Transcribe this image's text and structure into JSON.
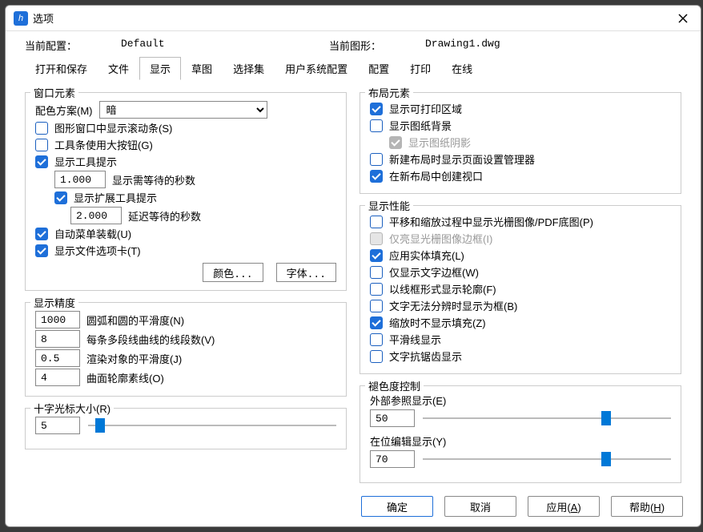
{
  "window": {
    "title": "选项"
  },
  "topbar": {
    "config_label": "当前配置：",
    "config_value": "Default",
    "drawing_label": "当前图形：",
    "drawing_value": "Drawing1.dwg"
  },
  "tabs": [
    "打开和保存",
    "文件",
    "显示",
    "草图",
    "选择集",
    "用户系统配置",
    "配置",
    "打印",
    "在线"
  ],
  "active_tab": "显示",
  "window_elements": {
    "title": "窗口元素",
    "colorscheme_label": "配色方案(M)",
    "colorscheme_value": "暗",
    "scrollbars": "图形窗口中显示滚动条(S)",
    "bigbtns": "工具条使用大按钮(G)",
    "tooltips": "显示工具提示",
    "tip_sec_val": "1.000",
    "tip_sec_lbl": "显示需等待的秒数",
    "ext_tips": "显示扩展工具提示",
    "delay_val": "2.000",
    "delay_lbl": "延迟等待的秒数",
    "auto_menu": "自动菜单装载(U)",
    "file_tabs": "显示文件选项卡(T)",
    "colors_btn": "颜色...",
    "fonts_btn": "字体..."
  },
  "precision": {
    "title": "显示精度",
    "arc_val": "1000",
    "arc_lbl": "圆弧和圆的平滑度(N)",
    "seg_val": "8",
    "seg_lbl": "每条多段线曲线的线段数(V)",
    "render_val": "0.5",
    "render_lbl": "渲染对象的平滑度(J)",
    "surf_val": "4",
    "surf_lbl": "曲面轮廓素线(O)"
  },
  "crosshair": {
    "title": "十字光标大小(R)",
    "value": "5",
    "percent": 3
  },
  "layout": {
    "title": "布局元素",
    "print_area": "显示可打印区域",
    "paper_bg": "显示图纸背景",
    "paper_shadow": "显示图纸阴影",
    "new_mgr": "新建布局时显示页面设置管理器",
    "new_vp": "在新布局中创建视口"
  },
  "perf": {
    "title": "显示性能",
    "raster": "平移和缩放过程中显示光栅图像/PDF底图(P)",
    "highlight": "仅亮显光栅图像边框(I)",
    "solid_fill": "应用实体填充(L)",
    "text_frame": "仅显示文字边框(W)",
    "outline": "以线框形式显示轮廓(F)",
    "text_box": "文字无法分辨时显示为框(B)",
    "no_fill_zoom": "缩放时不显示填充(Z)",
    "smooth_line": "平滑线显示",
    "text_aa": "文字抗锯齿显示"
  },
  "fade": {
    "title": "褪色度控制",
    "xref_lbl": "外部参照显示(E)",
    "xref_val": "50",
    "xref_pct": 72,
    "edit_lbl": "在位编辑显示(Y)",
    "edit_val": "70",
    "edit_pct": 72
  },
  "footer": {
    "ok": "确定",
    "cancel": "取消",
    "apply": "应用(A)",
    "help": "帮助(H)"
  }
}
